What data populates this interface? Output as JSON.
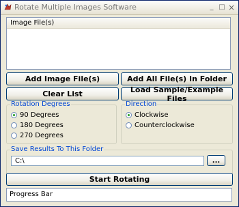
{
  "window": {
    "title": "Rotate Multiple Images Software"
  },
  "titlebar_buttons": {
    "minimize": "_",
    "maximize": "□",
    "close": "×"
  },
  "file_list": {
    "header": "Image File(s)"
  },
  "buttons": {
    "add_image_files": "Add Image File(s)",
    "add_all_files_in_folder": "Add All File(s) In Folder",
    "clear_list": "Clear List",
    "load_sample_files": "Load Sample/Example Files",
    "browse": "...",
    "start_rotating": "Start Rotating"
  },
  "rotation_degrees": {
    "title": "Rotation Degrees",
    "options": [
      "90 Degrees",
      "180 Degrees",
      "270 Degrees"
    ],
    "selected": "90 Degrees"
  },
  "direction": {
    "title": "Direction",
    "options": [
      "Clockwise",
      "Counterclockwise"
    ],
    "selected": "Clockwise"
  },
  "save_results": {
    "title": "Save Results To This Folder",
    "folder_value": "C:\\"
  },
  "progress_bar": {
    "label": "Progress Bar"
  }
}
